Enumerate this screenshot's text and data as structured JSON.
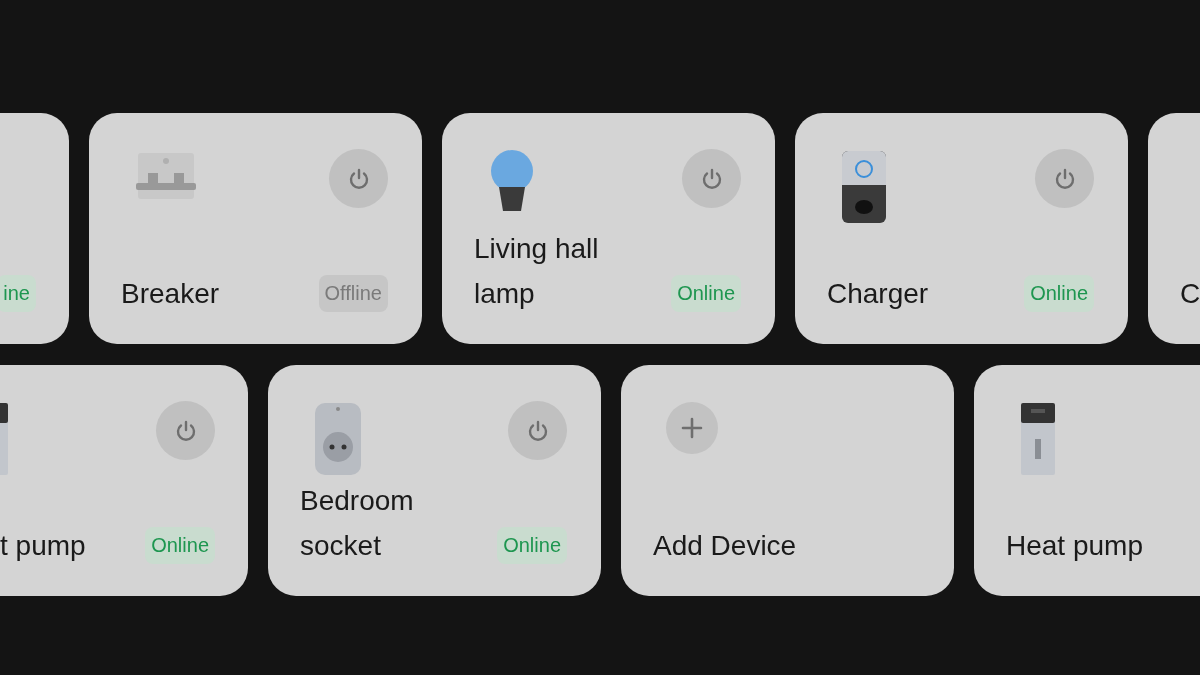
{
  "rows": [
    {
      "cards": [
        {
          "kind": "device",
          "status": {
            "text": "ine",
            "online": true
          }
        },
        {
          "kind": "device",
          "name": "Breaker",
          "status": {
            "text": "Offline",
            "online": false
          }
        },
        {
          "kind": "device",
          "name": "Living hall lamp",
          "status": {
            "text": "Online",
            "online": true
          }
        },
        {
          "kind": "device",
          "name": "Charger",
          "status": {
            "text": "Online",
            "online": true
          }
        },
        {
          "kind": "device",
          "name": "C"
        }
      ]
    },
    {
      "cards": [
        {
          "kind": "device",
          "name": "t pump",
          "status": {
            "text": "Online",
            "online": true
          }
        },
        {
          "kind": "device",
          "name": "Bedroom socket",
          "status": {
            "text": "Online",
            "online": true
          }
        },
        {
          "kind": "add",
          "name": "Add Device"
        },
        {
          "kind": "device",
          "name": "Heat pump"
        }
      ]
    }
  ]
}
